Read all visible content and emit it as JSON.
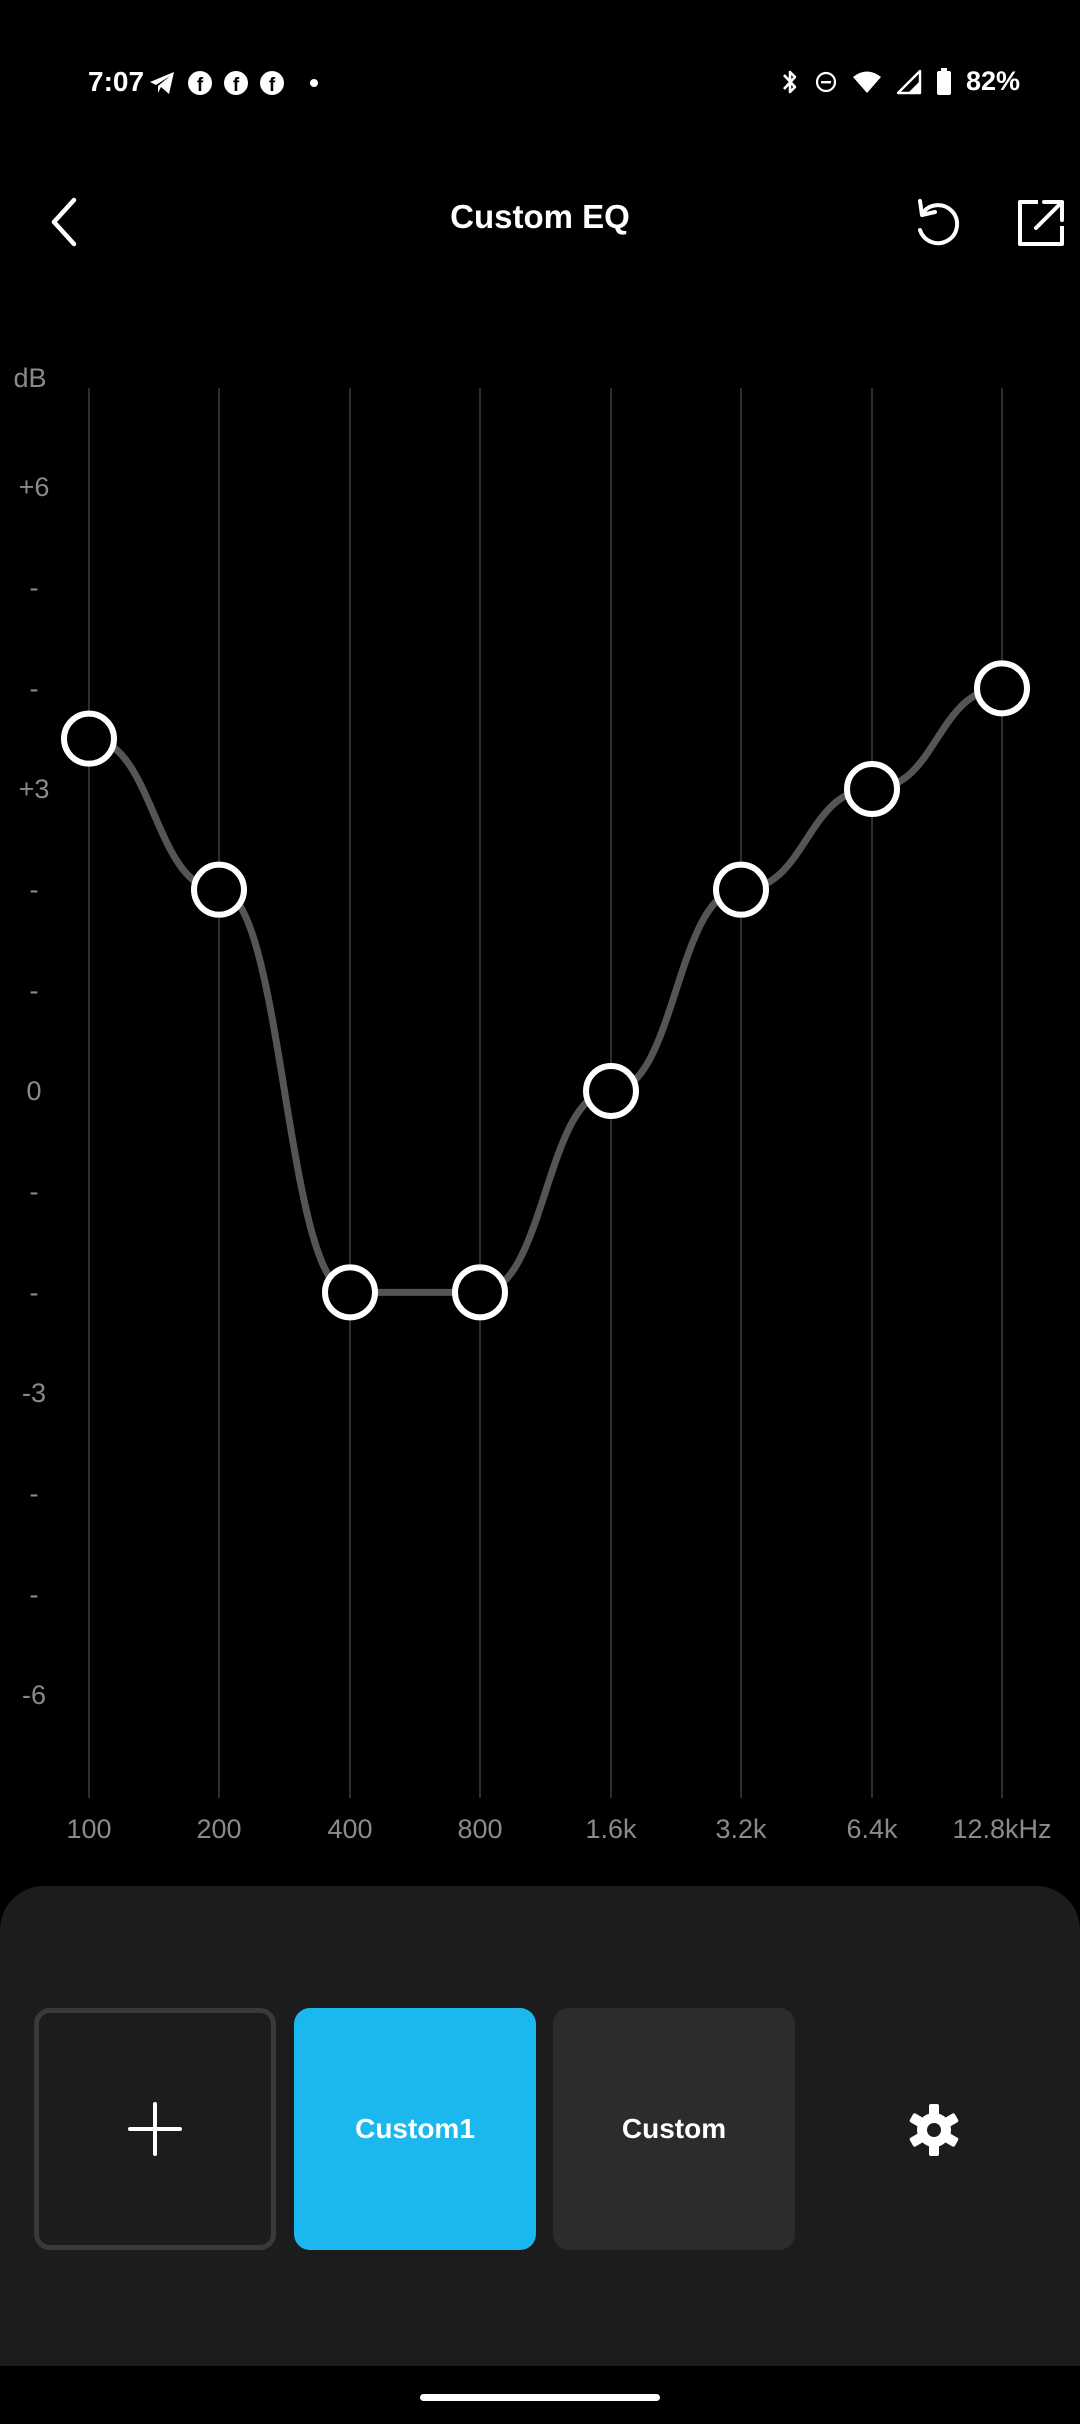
{
  "status_bar": {
    "time": "7:07",
    "battery_percent": "82%",
    "left_icons": [
      "telegram-icon",
      "facebook-icon",
      "facebook-icon",
      "facebook-icon",
      "dot-icon"
    ],
    "right_icons": [
      "bluetooth-icon",
      "dnd-icon",
      "wifi-icon",
      "signal-icon",
      "battery-icon"
    ]
  },
  "header": {
    "title": "Custom EQ",
    "back_icon": "chevron-left-icon",
    "reset_icon": "reset-icon",
    "share_icon": "share-icon"
  },
  "eq": {
    "y_unit_label": "dB",
    "y_tick_labels": [
      "+6",
      "-",
      "-",
      "+3",
      "-",
      "-",
      "0",
      "-",
      "-",
      "-3",
      "-",
      "-",
      "-6"
    ],
    "x_labels": [
      "100",
      "200",
      "400",
      "800",
      "1.6k",
      "3.2k",
      "6.4k",
      "12.8kHz"
    ],
    "bands_db": [
      3.5,
      2.0,
      -2.0,
      -2.0,
      0.0,
      2.0,
      3.0,
      4.0
    ],
    "curve_color": "#555555",
    "grid_color": "#2e2e2e",
    "handle_color": "#ffffff"
  },
  "presets": {
    "add_icon": "plus-icon",
    "items": [
      {
        "label": "Custom1",
        "active": true
      },
      {
        "label": "Custom",
        "active": false
      }
    ],
    "settings_icon": "gear-icon",
    "active_color": "#1ab8ee"
  }
}
